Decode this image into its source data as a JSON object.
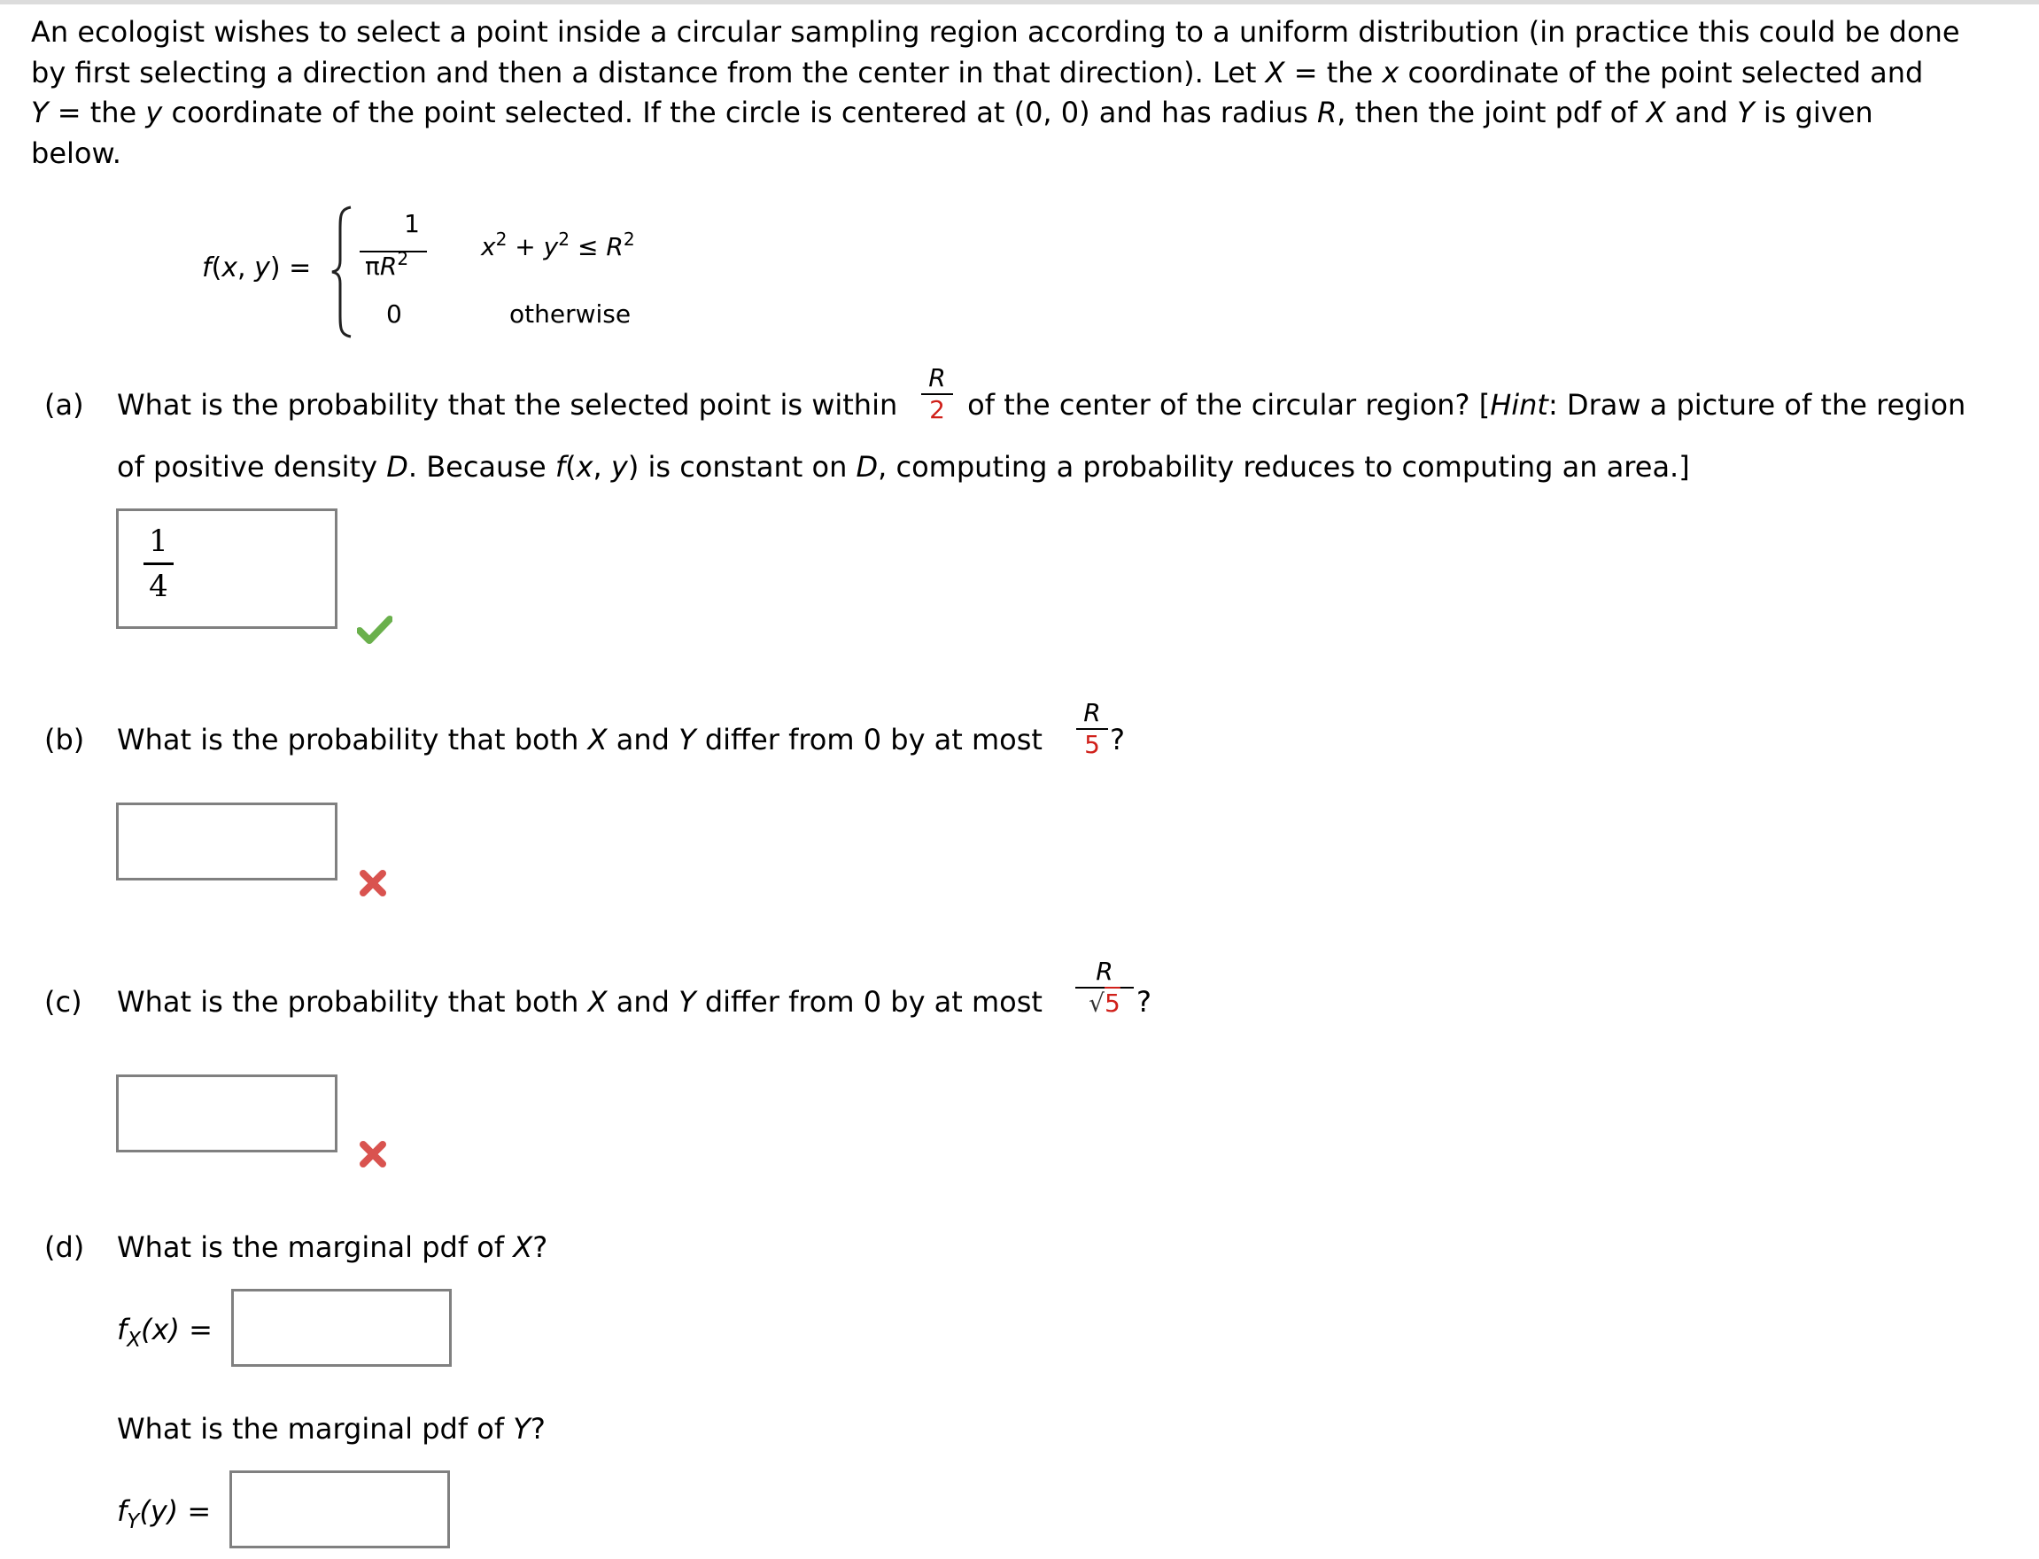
{
  "intro": {
    "line1": "An ecologist wishes to select a point inside a circular sampling region according to a uniform distribution (in practice this could be done",
    "line2_a": "by first selecting a direction and then a distance from the center in that direction). Let ",
    "line2_X": "X",
    "line2_b": " = the ",
    "line2_x": "x",
    "line2_c": " coordinate of the point selected and",
    "line3_Y": "Y",
    "line3_a": " = the ",
    "line3_y": "y",
    "line3_b": " coordinate of the point selected. If the circle is centered at (0, 0) and has radius ",
    "line3_R": "R",
    "line3_c": ", then the joint pdf of ",
    "line3_X": "X",
    "line3_d": " and ",
    "line3_Y2": "Y",
    "line3_e": " is given",
    "line4": "below."
  },
  "formula": {
    "lhs": "f(x, y) =",
    "case1_numerator": "1",
    "case1_denominator_pi": "π",
    "case1_denominator_R": "R",
    "case1_denominator_exp": "2",
    "case1_condition_x": "x",
    "case1_condition_exp1": "2",
    "case1_condition_plus": " + ",
    "case1_condition_y": "y",
    "case1_condition_exp2": "2",
    "case1_condition_le": " ≤ ",
    "case1_condition_R": "R",
    "case1_condition_exp3": "2",
    "case2_value": "0",
    "case2_condition": "otherwise"
  },
  "parts": {
    "a": {
      "label": "(a)",
      "text_before": "What is the probability that the selected point is within",
      "frac_num": "R",
      "frac_den": "2",
      "text_after_1": " of the center of the circular region? [",
      "hint_word": "Hint",
      "text_after_2": ": Draw a picture of the region",
      "line2_a": "of positive density ",
      "line2_D": "D",
      "line2_b": ". Because ",
      "line2_f": "f",
      "line2_c": "(",
      "line2_x": "x",
      "line2_d": ", ",
      "line2_y": "y",
      "line2_e": ") is constant on ",
      "line2_D2": "D",
      "line2_f2": ", computing a probability reduces to computing an area.]",
      "answer_num": "1",
      "answer_den": "4",
      "status": "correct",
      "status_icon": "check-icon"
    },
    "b": {
      "label": "(b)",
      "text_a": "What is the probability that both ",
      "X": "X",
      "text_b": " and ",
      "Y": "Y",
      "text_c": " differ from 0 by at most ",
      "frac_num": "R",
      "frac_den": "5",
      "text_after": "?",
      "answer": "",
      "status": "incorrect",
      "status_icon": "x-icon"
    },
    "c": {
      "label": "(c)",
      "text_a": "What is the probability that both ",
      "X": "X",
      "text_b": " and ",
      "Y": "Y",
      "text_c": " differ from 0 by at most ",
      "frac_num": "R",
      "frac_den_root": "√",
      "frac_den": "5",
      "text_after": "?",
      "answer": "",
      "status": "incorrect",
      "status_icon": "x-icon"
    },
    "d": {
      "label": "(d)",
      "q1_a": "What is the marginal pdf of ",
      "q1_X": "X",
      "q1_b": "?",
      "fx_f": "f",
      "fx_sub": "X",
      "fx_arg": "(x)",
      "fx_eq": " =",
      "fx_answer": "",
      "q2_a": "What is the marginal pdf of ",
      "q2_Y": "Y",
      "q2_b": "?",
      "fy_f": "f",
      "fy_sub": "Y",
      "fy_arg": "(y)",
      "fy_eq": " =",
      "fy_answer": ""
    }
  },
  "colors": {
    "emphasis_red": "#d0201a",
    "correct_green": "#5cb85c",
    "incorrect_red": "#d9534f",
    "input_border": "#808080"
  }
}
